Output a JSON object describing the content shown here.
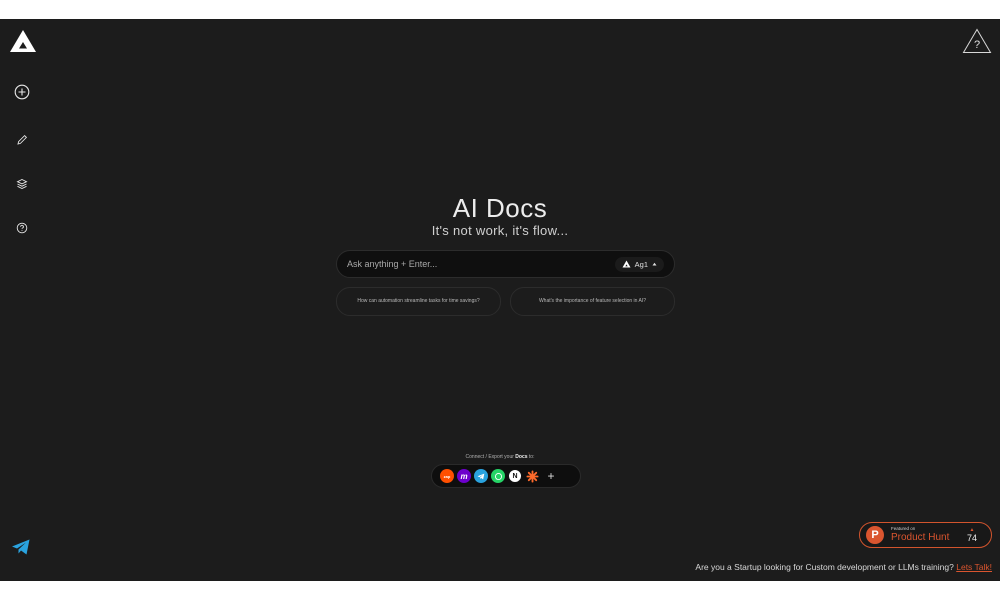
{
  "hero": {
    "title": "AI Docs",
    "subtitle": "It's not work, it's flow..."
  },
  "ask": {
    "placeholder": "Ask anything + Enter...",
    "model_label": "Ag1"
  },
  "suggestions": [
    "How can automation streamline tasks for time savings?",
    "What's the importance of feature selection in AI?"
  ],
  "connect": {
    "label_prefix": "Connect / Export your ",
    "label_bold": "Docs",
    "label_suffix": " to:",
    "apps": [
      {
        "name": "zapier",
        "glyph": "zap",
        "color": "#ff4f00"
      },
      {
        "name": "make",
        "glyph": "m",
        "color": "#6d00cc"
      },
      {
        "name": "telegram",
        "glyph": "",
        "color": "#2aa3df"
      },
      {
        "name": "whatsapp",
        "glyph": "",
        "color": "#25d366"
      },
      {
        "name": "notion",
        "glyph": "N",
        "color": "#ffffff"
      },
      {
        "name": "asterisk",
        "glyph": "",
        "color": "#ff6a2b"
      }
    ],
    "more": "+"
  },
  "product_hunt": {
    "featured": "Featured on",
    "name": "Product Hunt",
    "arrow": "▲",
    "votes": "74"
  },
  "footer": {
    "text": "Are you a Startup looking for Custom development or LLMs training?",
    "link": "Lets Talk!"
  },
  "colors": {
    "background": "#1c1c1c",
    "accent": "#da552f",
    "telegram": "#2aa3df"
  }
}
